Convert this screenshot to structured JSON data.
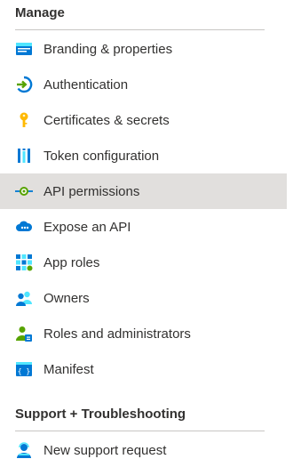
{
  "sections": {
    "manage": {
      "title": "Manage",
      "items": [
        {
          "label": "Branding & properties",
          "icon": "branding-icon"
        },
        {
          "label": "Authentication",
          "icon": "authentication-icon"
        },
        {
          "label": "Certificates & secrets",
          "icon": "key-icon"
        },
        {
          "label": "Token configuration",
          "icon": "token-bars-icon"
        },
        {
          "label": "API permissions",
          "icon": "api-permissions-icon",
          "selected": true
        },
        {
          "label": "Expose an API",
          "icon": "cloud-api-icon"
        },
        {
          "label": "App roles",
          "icon": "app-roles-grid-icon"
        },
        {
          "label": "Owners",
          "icon": "owners-icon"
        },
        {
          "label": "Roles and administrators",
          "icon": "roles-admin-icon"
        },
        {
          "label": "Manifest",
          "icon": "manifest-icon"
        }
      ]
    },
    "support": {
      "title": "Support + Troubleshooting",
      "items": [
        {
          "label": "New support request",
          "icon": "support-agent-icon"
        }
      ]
    }
  },
  "colors": {
    "selected_bg": "#e1dfdd",
    "divider": "#c8c6c4",
    "text": "#323130",
    "accent_blue": "#0078d4",
    "key_yellow": "#ffb900",
    "green": "#57a300"
  }
}
